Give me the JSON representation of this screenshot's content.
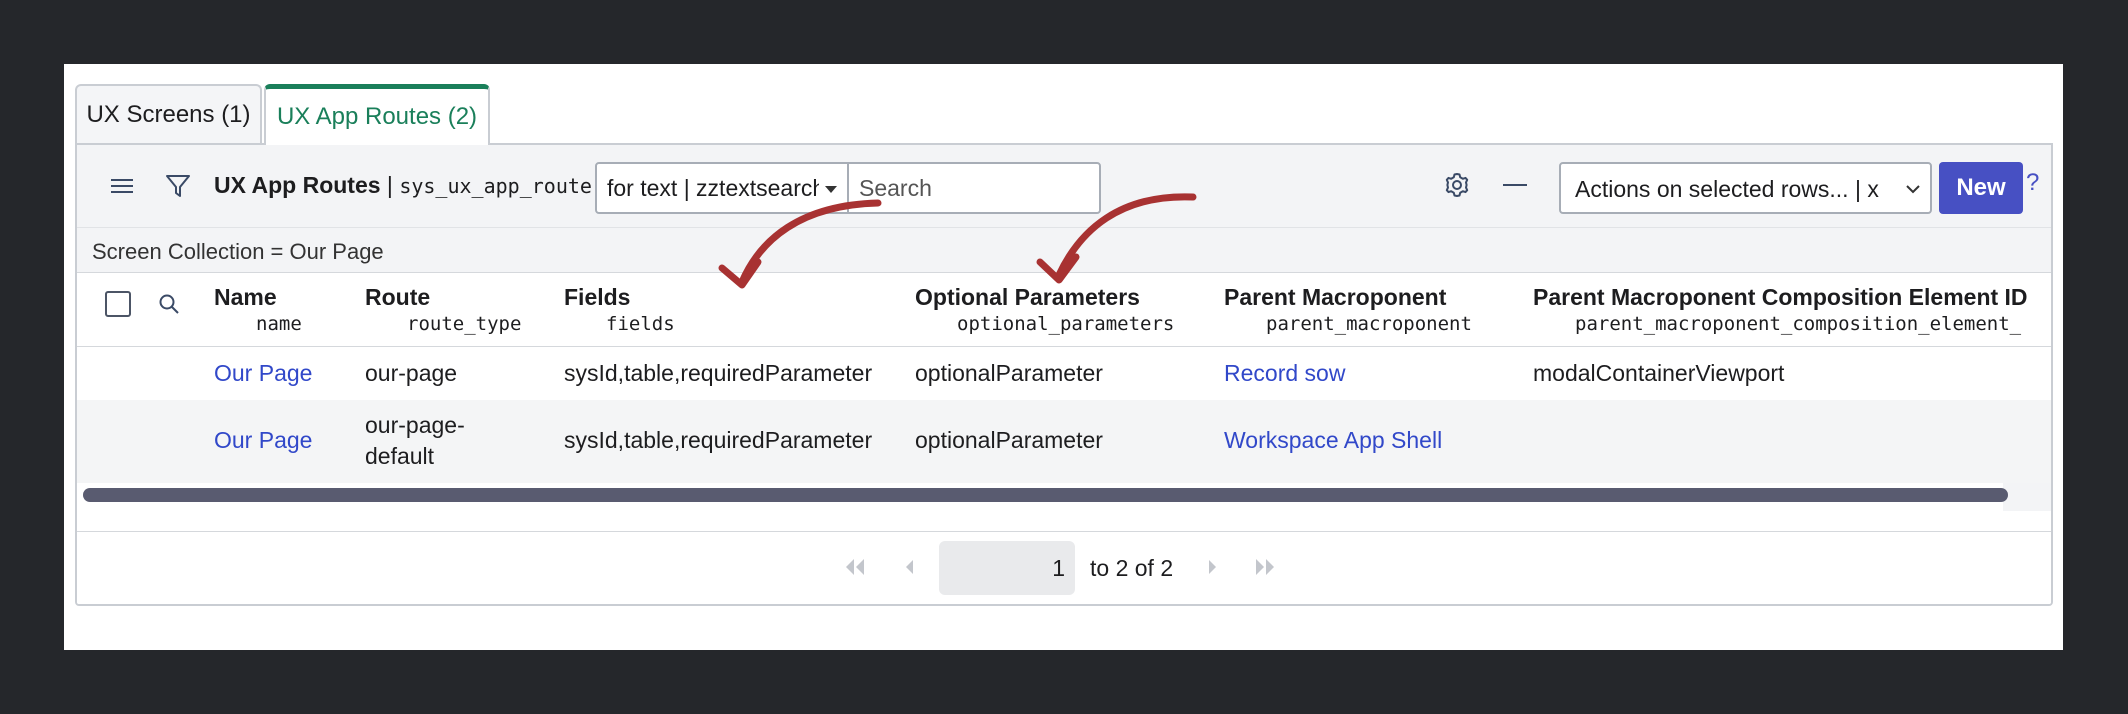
{
  "tabs": [
    {
      "label": "UX Screens (1)",
      "active": false
    },
    {
      "label": "UX App Routes (2)",
      "active": true
    }
  ],
  "toolbar": {
    "list_name": "UX App Routes",
    "separator": " | ",
    "table_name": "sys_ux_app_route",
    "search_field": "for text | zztextsearchyh",
    "search_placeholder": "Search",
    "actions_select": "Actions on selected rows... | x",
    "new_label": "New",
    "help": "?"
  },
  "breadcrumb": "Screen Collection = Our Page",
  "columns": [
    {
      "label": "Name",
      "field": "name"
    },
    {
      "label": "Route",
      "field": "route_type"
    },
    {
      "label": "Fields",
      "field": "fields"
    },
    {
      "label": "Optional Parameters",
      "field": "optional_parameters"
    },
    {
      "label": "Parent Macroponent",
      "field": "parent_macroponent"
    },
    {
      "label": "Parent Macroponent Composition Element ID",
      "field": "parent_macroponent_composition_element_"
    }
  ],
  "rows": [
    {
      "name": "Our Page",
      "route": "our-page",
      "fields": "sysId,table,requiredParameter",
      "optional_parameters": "optionalParameter",
      "parent_macroponent": "Record sow",
      "composition_element_id": "modalContainerViewport"
    },
    {
      "name": "Our Page",
      "route": "our-page-default",
      "fields": "sysId,table,requiredParameter",
      "optional_parameters": "optionalParameter",
      "parent_macroponent": "Workspace App Shell",
      "composition_element_id": ""
    }
  ],
  "pagination": {
    "current": "1",
    "range_text": "to 2 of 2"
  },
  "colors": {
    "accent_green": "#1a7f5a",
    "link_blue": "#3148c9",
    "button_indigo": "#4750c3",
    "annotation_red": "#a83232"
  },
  "icons": [
    "hamburger-menu-icon",
    "filter-icon",
    "gear-icon",
    "minus-icon",
    "chevron-down-icon",
    "search-icon",
    "first-page-icon",
    "previous-page-icon",
    "next-page-icon",
    "last-page-icon"
  ]
}
